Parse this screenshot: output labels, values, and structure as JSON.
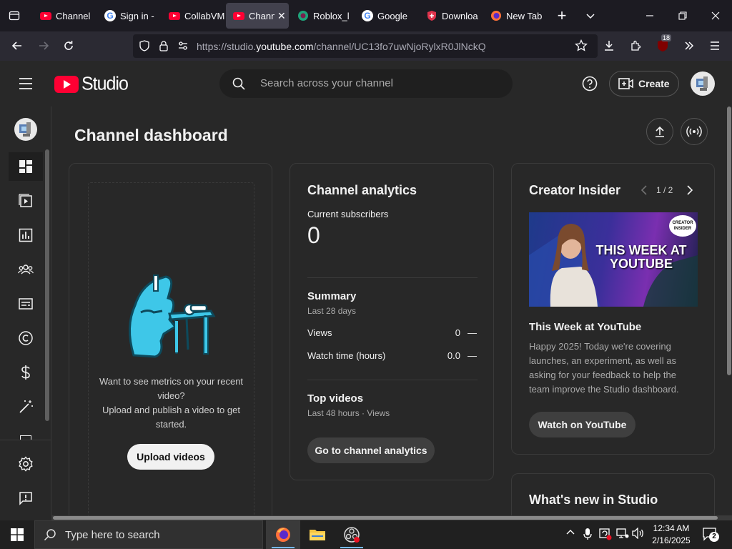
{
  "browser": {
    "tabs": [
      {
        "label": "Channel",
        "icon": "youtube-icon"
      },
      {
        "label": "Sign in -",
        "icon": "google-icon"
      },
      {
        "label": "CollabVM",
        "icon": "youtube-icon"
      },
      {
        "label": "Chann",
        "icon": "youtube-icon",
        "active": true
      },
      {
        "label": "Roblox_l",
        "icon": "roblox-icon"
      },
      {
        "label": "Google",
        "icon": "google-icon"
      },
      {
        "label": "Downloa",
        "icon": "shield-icon"
      },
      {
        "label": "New Tab",
        "icon": "firefox-icon"
      }
    ],
    "url_prefix": "https://studio.",
    "url_domain": "youtube.com",
    "url_path": "/channel/UC13fo7uwNjoRylxR0JlNckQ",
    "extension_badge": "18"
  },
  "studio": {
    "logo_text": "Studio",
    "search_placeholder": "Search across your channel",
    "create_label": "Create"
  },
  "dashboard": {
    "page_title": "Channel dashboard",
    "upload_card": {
      "message_line1": "Want to see metrics on your recent video?",
      "message_line2": "Upload and publish a video to get started.",
      "button_label": "Upload videos"
    },
    "analytics": {
      "title": "Channel analytics",
      "subscribers_label": "Current subscribers",
      "subscribers_value": "0",
      "summary_title": "Summary",
      "summary_period": "Last 28 days",
      "views_label": "Views",
      "views_value": "0",
      "views_trend": "—",
      "watch_label": "Watch time (hours)",
      "watch_value": "0.0",
      "watch_trend": "—",
      "top_title": "Top videos",
      "top_period": "Last 48 hours · Views",
      "button_label": "Go to channel analytics"
    },
    "insider": {
      "title": "Creator Insider",
      "pager": "1 / 2",
      "thumb_line1": "THIS WEEK AT",
      "thumb_line2": "YOUTUBE",
      "thumb_badge_line1": "CREATOR",
      "thumb_badge_line2": "INSIDER",
      "video_title": "This Week at YouTube",
      "description": "Happy 2025! Today we're covering launches, an experiment, as well as asking for your feedback to help the team improve the Studio dashboard.",
      "button_label": "Watch on YouTube"
    },
    "whats_new": {
      "title": "What's new in Studio"
    }
  },
  "taskbar": {
    "search_placeholder": "Type here to search",
    "time": "12:34 AM",
    "date": "2/16/2025",
    "notification_count": "2"
  },
  "colors": {
    "accent_red": "#ff0033",
    "background": "#282828",
    "card_border": "#3a3a3a"
  }
}
